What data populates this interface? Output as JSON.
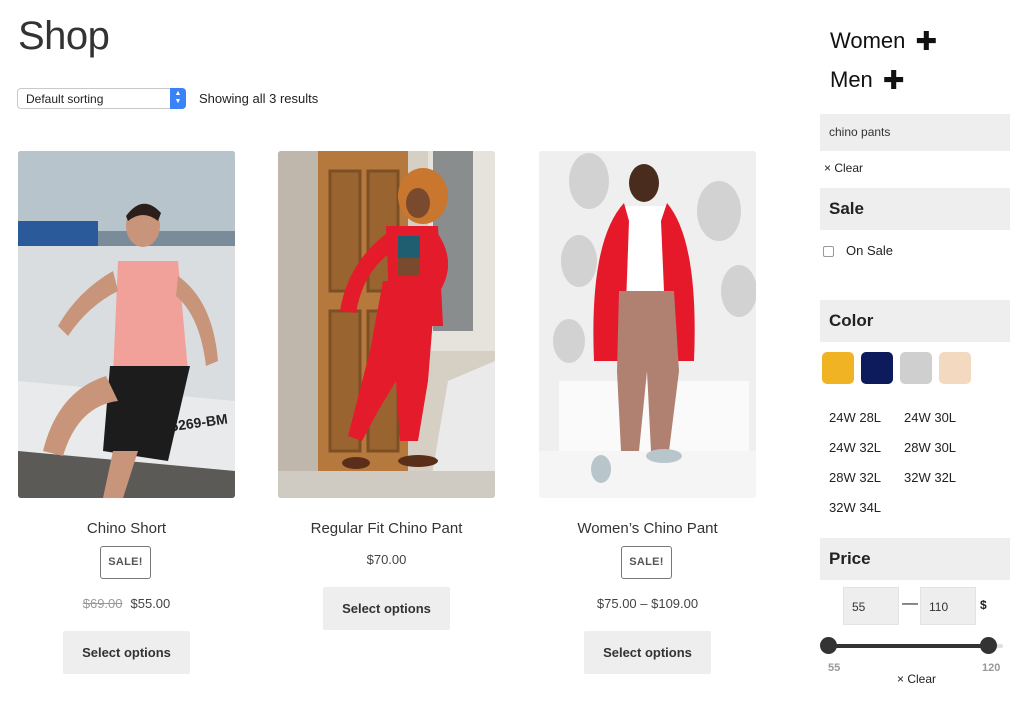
{
  "page": {
    "title": "Shop"
  },
  "toolbar": {
    "sort_value": "Default sorting",
    "result_count": "Showing all 3 results"
  },
  "products": [
    {
      "name": "Chino Short",
      "badge": "SALE!",
      "price_old": "$69.00",
      "price": "$55.00",
      "button": "Select options"
    },
    {
      "name": "Regular Fit Chino Pant",
      "price": "$70.00",
      "button": "Select options"
    },
    {
      "name": "Women’s Chino Pant",
      "badge": "SALE!",
      "price": "$75.00 – $109.00",
      "button": "Select options"
    }
  ],
  "sidebar": {
    "categories": [
      {
        "label": "Women",
        "icon": "plus-icon"
      },
      {
        "label": "Men",
        "icon": "plus-icon"
      }
    ],
    "active_filter": {
      "label": "chino pants",
      "clear": "× Clear"
    },
    "sale": {
      "heading": "Sale",
      "option": "On Sale",
      "checked": false
    },
    "color": {
      "heading": "Color",
      "swatches": [
        "#f0b323",
        "#0d1a5c",
        "#cfcfcf",
        "#f2d9bf"
      ],
      "sizes": [
        "24W 28L",
        "24W 30L",
        "24W 32L",
        "28W 30L",
        "28W 32L",
        "32W 32L",
        "32W 34L"
      ]
    },
    "price": {
      "heading": "Price",
      "min_value": "55",
      "max_value": "110",
      "currency": "$",
      "range_min_label": "55",
      "range_max_label": "120",
      "clear": "× Clear"
    }
  }
}
